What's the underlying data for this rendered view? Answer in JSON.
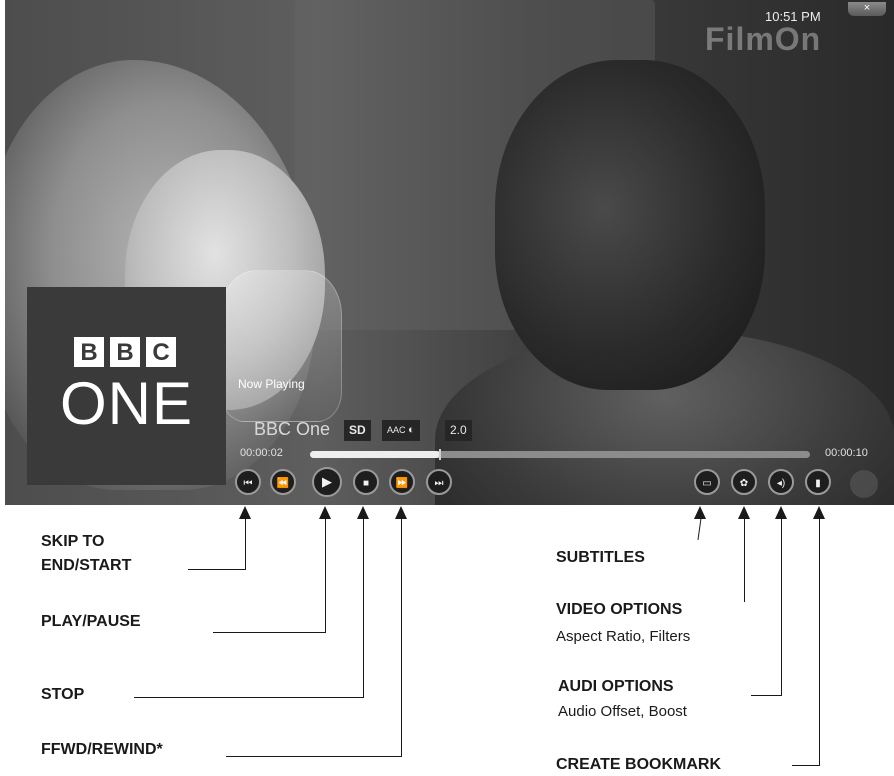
{
  "player": {
    "clock": "10:51 PM",
    "close_label": "×",
    "brand_logo": "FilmOn",
    "channel_logo": {
      "letters": [
        "B",
        "B",
        "C"
      ],
      "word": "ONE"
    },
    "now_playing_label": "Now Playing",
    "channel_name": "BBC One",
    "tags": {
      "quality": "SD",
      "codec": "AAC",
      "codec_icon": "dolby-icon",
      "channels": "2.0"
    },
    "time_elapsed": "00:00:02",
    "time_total": "00:00:10",
    "progress": 0.26,
    "controls": {
      "skip_start": "skip-start-icon",
      "rewind": "rewind-icon",
      "play": "play-icon",
      "stop": "stop-icon",
      "fast_forward": "fast-forward-icon",
      "skip_end": "skip-end-icon",
      "subtitles": "subtitles-icon",
      "video_options": "film-reel-icon",
      "audio_options": "speaker-icon",
      "bookmark": "document-icon"
    }
  },
  "annotations": {
    "skip_line1": "SKIP TO",
    "skip_line2": "END/START",
    "play_pause": "PLAY/PAUSE",
    "stop": "STOP",
    "ffwd_rewind": "FFWD/REWIND*",
    "subtitles": "SUBTITLES",
    "video_options": "VIDEO OPTIONS",
    "video_options_sub": "Aspect Ratio, Filters",
    "audio_options": "AUDI OPTIONS",
    "audio_options_sub": "Audio Offset, Boost",
    "create_bookmark": "CREATE BOOKMARK"
  }
}
